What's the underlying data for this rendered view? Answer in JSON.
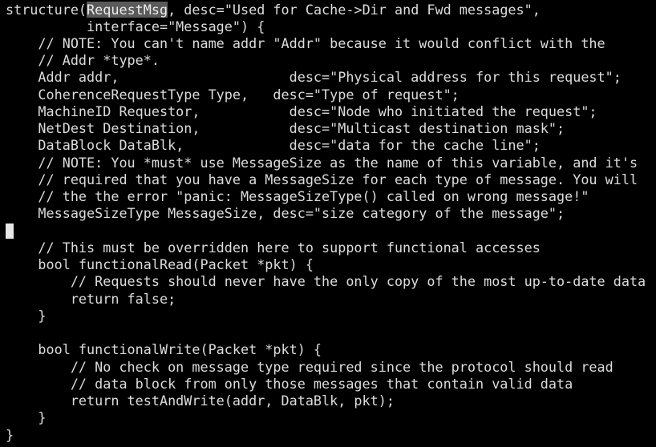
{
  "editor": {
    "cursor_line": 14,
    "highlight": {
      "line": 1,
      "prefix": "structure(",
      "word": "RequestMsg",
      "suffix": ", desc=\"Used for Cache->Dir and Fwd messages\","
    },
    "lines": [
      "structure(RequestMsg, desc=\"Used for Cache->Dir and Fwd messages\",",
      "          interface=\"Message\") {",
      "    // NOTE: You can't name addr \"Addr\" because it would conflict with the",
      "    // Addr *type*.",
      "    Addr addr,                     desc=\"Physical address for this request\";",
      "    CoherenceRequestType Type,   desc=\"Type of request\";",
      "    MachineID Requestor,           desc=\"Node who initiated the request\";",
      "    NetDest Destination,           desc=\"Multicast destination mask\";",
      "    DataBlock DataBlk,             desc=\"data for the cache line\";",
      "    // NOTE: You *must* use MessageSize as the name of this variable, and it's",
      "    // required that you have a MessageSize for each type of message. You will",
      "    // the the error \"panic: MessageSizeType() called on wrong message!\"",
      "    MessageSizeType MessageSize, desc=\"size category of the message\";",
      "",
      "    // This must be overridden here to support functional accesses",
      "    bool functionalRead(Packet *pkt) {",
      "        // Requests should never have the only copy of the most up-to-date data",
      "        return false;",
      "    }",
      "",
      "    bool functionalWrite(Packet *pkt) {",
      "        // No check on message type required since the protocol should read",
      "        // data block from only those messages that contain valid data",
      "        return testAndWrite(addr, DataBlk, pkt);",
      "    }",
      "}"
    ]
  }
}
